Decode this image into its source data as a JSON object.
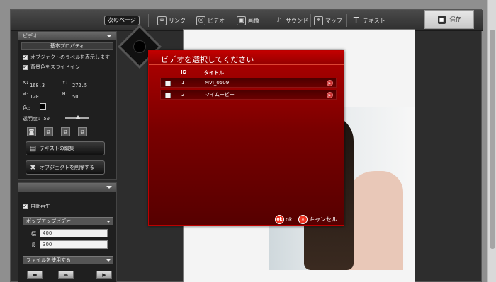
{
  "toolbar": {
    "next_page": "次のページ",
    "tools": [
      {
        "label": "リンク",
        "icon": "link-icon"
      },
      {
        "label": "ビデオ",
        "icon": "film-reel-icon"
      },
      {
        "label": "画像",
        "icon": "image-icon"
      },
      {
        "label": "サウンド",
        "icon": "music-note-icon"
      },
      {
        "label": "マップ",
        "icon": "map-icon"
      },
      {
        "label": "テキスト",
        "icon": "text-icon"
      }
    ],
    "save_label": "保存"
  },
  "left_panel": {
    "video_section": {
      "header": "ビデオ",
      "basic_props": "基本プロパティ",
      "show_label": "オブジェクトのラベルを表示します",
      "bg_slide": "背景色をスライドイン",
      "x_label": "X:",
      "x_value": "168.3",
      "y_label": "Y:",
      "y_value": "272.5",
      "w_label": "W:",
      "w_value": "120",
      "h_label": "H:",
      "h_value": "50",
      "color_label": "色:",
      "opacity_label": "透明度: 50",
      "edit_text": "テキストの編集",
      "delete_object": "オブジェクトを削除する"
    },
    "popup_section": {
      "autoplay": "自動再生",
      "popup_video": "ポップアップビデオ",
      "width_label": "幅",
      "width_value": "400",
      "height_label": "長",
      "height_value": "300",
      "use_file": "ファイルを使用する"
    }
  },
  "modal": {
    "title": "ビデオを選択してください",
    "col_id": "ID",
    "col_title": "タイトル",
    "rows": [
      {
        "id": "1",
        "title": "MVI_0509"
      },
      {
        "id": "2",
        "title": "マイムービー"
      }
    ],
    "ok_icon": "ok",
    "ok_label": "ok",
    "cancel_label": "キャンセル"
  },
  "colors": {
    "modal_red": "#b00000",
    "panel_dark": "#1f1f1f",
    "toolbar": "#3a3a3a"
  }
}
